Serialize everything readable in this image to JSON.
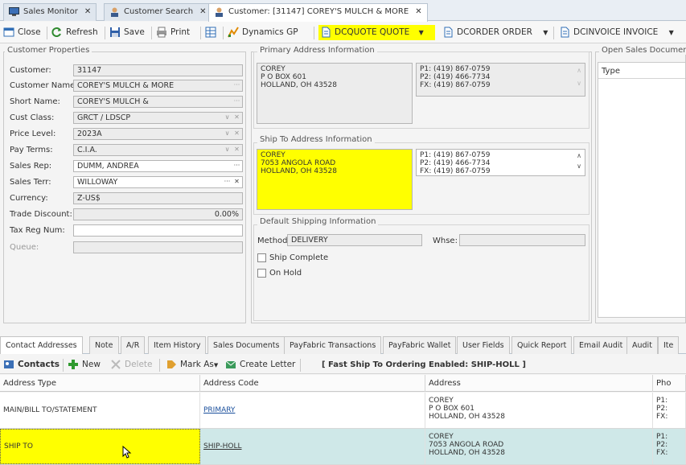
{
  "tabs": [
    {
      "label": "Sales Monitor",
      "close": "✕"
    },
    {
      "label": "Customer Search",
      "close": "✕"
    },
    {
      "label": "Customer: [31147] COREY'S MULCH & MORE",
      "close": "✕"
    }
  ],
  "toolbar": {
    "close": "Close",
    "refresh": "Refresh",
    "save": "Save",
    "print": "Print",
    "dynamics": "Dynamics GP",
    "quote": "DCQUOTE QUOTE",
    "order": "DCORDER ORDER",
    "invoice": "DCINVOICE INVOICE",
    "dropdown": "▼"
  },
  "customer_properties": {
    "title": "Customer Properties",
    "fields": [
      {
        "label": "Customer:",
        "value": "31147"
      },
      {
        "label": "Customer Name:",
        "value": "COREY'S MULCH & MORE"
      },
      {
        "label": "Short Name:",
        "value": "COREY'S MULCH &"
      },
      {
        "label": "Cust Class:",
        "value": "GRCT / LDSCP"
      },
      {
        "label": "Price Level:",
        "value": "2023A"
      },
      {
        "label": "Pay Terms:",
        "value": "C.I.A."
      },
      {
        "label": "Sales Rep:",
        "value": "DUMM, ANDREA"
      },
      {
        "label": "Sales Terr:",
        "value": "WILLOWAY"
      },
      {
        "label": "Currency:",
        "value": "Z-US$"
      },
      {
        "label": "Trade Discount:",
        "value": "0.00%"
      },
      {
        "label": "Tax Reg Num:",
        "value": ""
      },
      {
        "label": "Queue:",
        "value": ""
      }
    ]
  },
  "primary_address": {
    "title": "Primary Address Information",
    "lines": [
      "COREY",
      "P O BOX 601",
      "HOLLAND, OH 43528"
    ],
    "phones": [
      "P1: (419) 867-0759",
      "P2: (419) 466-7734",
      "FX: (419) 867-0759"
    ]
  },
  "ship_to_address": {
    "title": "Ship To Address Information",
    "lines": [
      "COREY",
      "7053 ANGOLA ROAD",
      "HOLLAND, OH 43528"
    ],
    "phones": [
      "P1: (419) 867-0759",
      "P2: (419) 466-7734",
      "FX: (419) 867-0759"
    ]
  },
  "shipping": {
    "title": "Default Shipping Information",
    "method_label": "Method",
    "method_value": "DELIVERY",
    "whse_label": "Whse:",
    "whse_value": "",
    "ship_complete": "Ship Complete",
    "on_hold": "On Hold"
  },
  "open_sales": {
    "title": "Open Sales Documents",
    "col_type": "Type"
  },
  "bottom_tabs": [
    "Contact Addresses",
    "Note",
    "A/R",
    "Item History",
    "Sales Documents",
    "PayFabric Transactions",
    "PayFabric Wallet",
    "User Fields",
    "Quick Report",
    "Email Audit",
    "Audit",
    "Ite"
  ],
  "subbar": {
    "contacts": "Contacts",
    "new": "New",
    "delete": "Delete",
    "mark_as": "Mark As",
    "create_letter": "Create Letter",
    "notice": "[ Fast Ship To Ordering Enabled: SHIP-HOLL ]"
  },
  "grid": {
    "headers": [
      "Address Type",
      "Address Code",
      "Address",
      "Pho"
    ],
    "rows": [
      {
        "type": "MAIN/BILL TO/STATEMENT",
        "code": "PRIMARY",
        "address": [
          "COREY",
          "P O BOX 601",
          "HOLLAND, OH 43528"
        ],
        "phone": [
          "P1:",
          "P2:",
          "FX:"
        ]
      },
      {
        "type": "SHIP TO",
        "code": "SHIP-HOLL",
        "address": [
          "COREY",
          "7053 ANGOLA ROAD",
          "HOLLAND, OH 43528"
        ],
        "phone": [
          "P1:",
          "P2:",
          "FX:"
        ]
      }
    ]
  },
  "colors": {
    "highlight": "#ffff00",
    "selected_row": "#cfe8e8",
    "link": "#1a4f9c"
  }
}
